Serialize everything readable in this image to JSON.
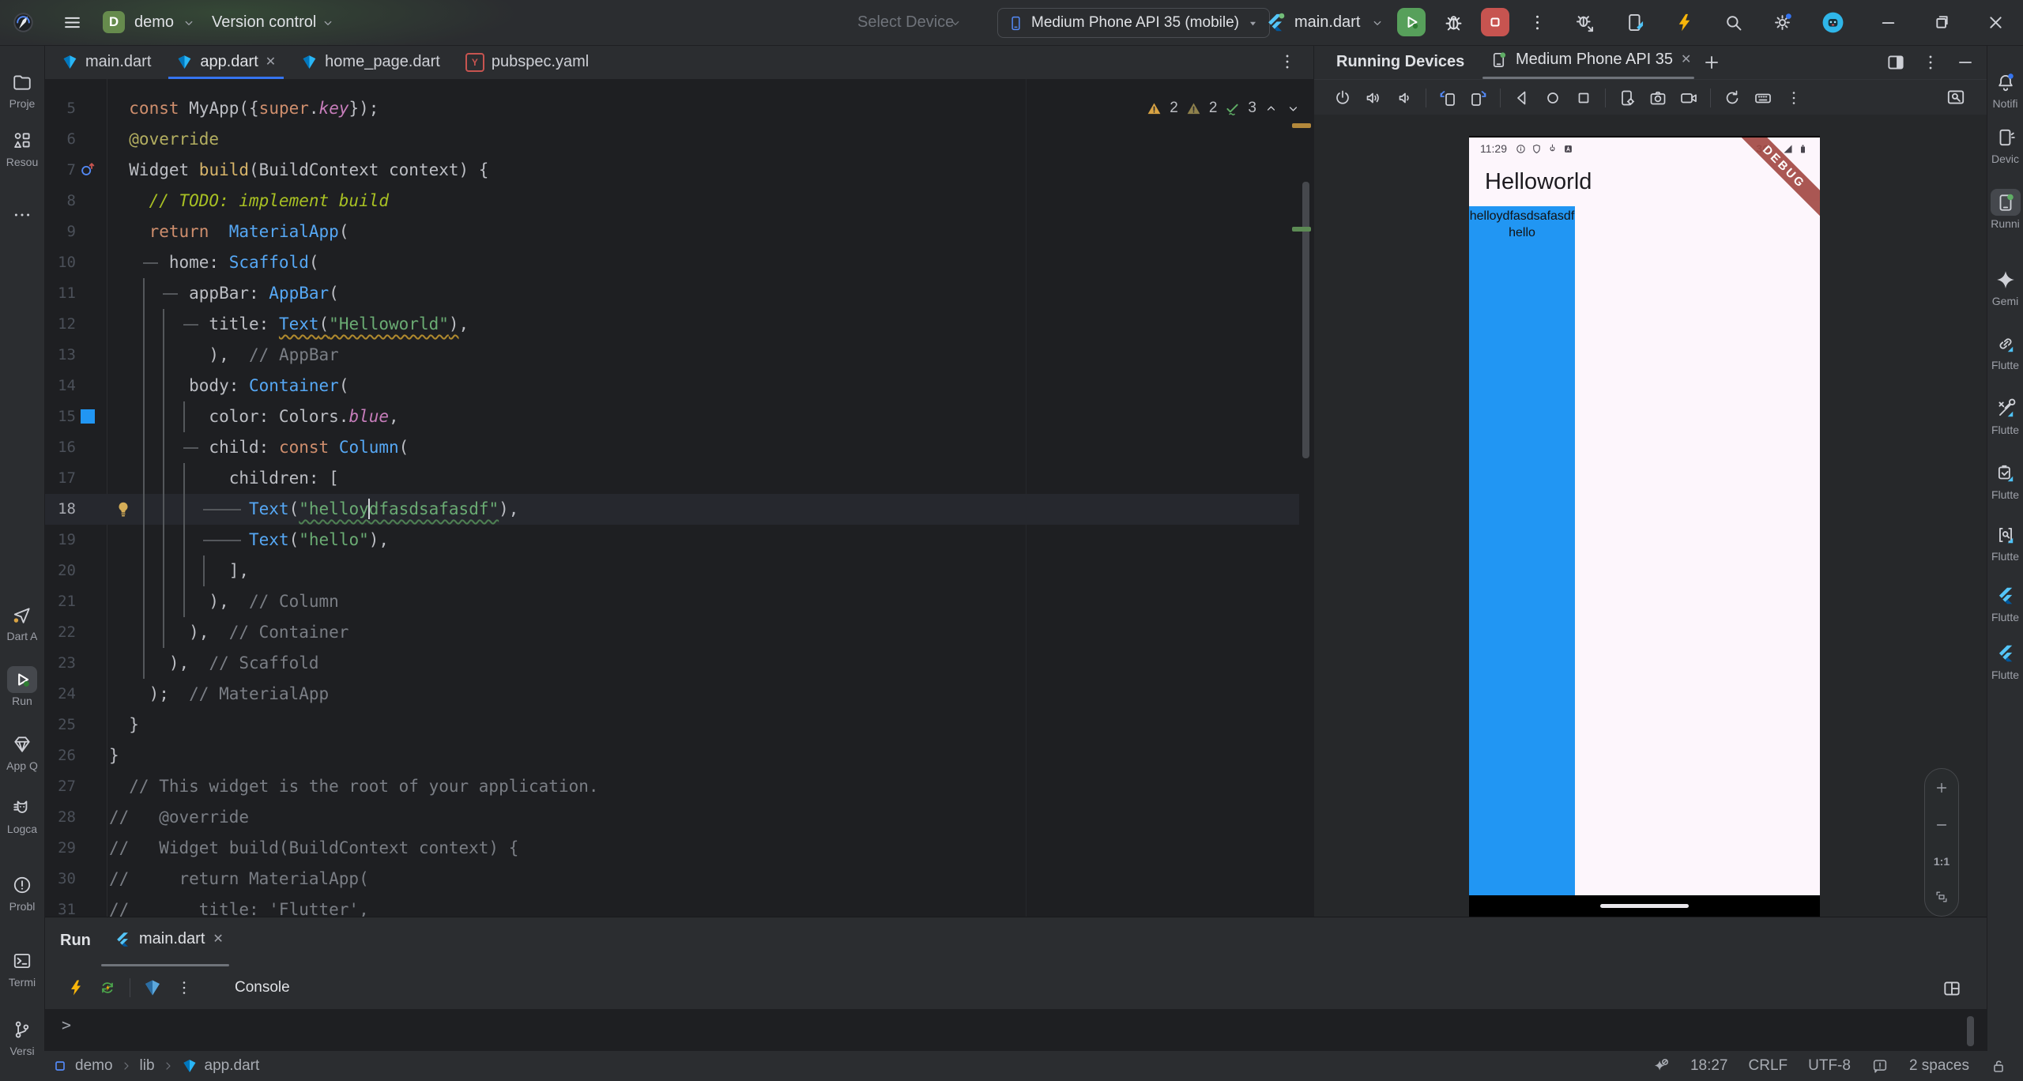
{
  "titlebar": {
    "project": "demo",
    "project_badge": "D",
    "menu": "Version control",
    "select_device": "Select Device",
    "device": "Medium Phone API 35 (mobile)",
    "run_config": "main.dart",
    "right_icons": [
      "bug-attach",
      "flutter-attach",
      "bolt",
      "search",
      "settings",
      "avatar",
      "minimize",
      "restore",
      "close"
    ]
  },
  "editor": {
    "tabs": [
      {
        "label": "main.dart",
        "icon": "dart",
        "active": false,
        "closable": false
      },
      {
        "label": "app.dart",
        "icon": "dart",
        "active": true,
        "closable": true
      },
      {
        "label": "home_page.dart",
        "icon": "dart",
        "active": false,
        "closable": false
      },
      {
        "label": "pubspec.yaml",
        "icon": "yaml",
        "active": false,
        "closable": false
      }
    ],
    "inspections": {
      "warnings": "2",
      "weak_warnings": "2",
      "passed": "3"
    },
    "lines": [
      {
        "n": 5,
        "t": [
          [
            "kw",
            "  const"
          ],
          [
            "id",
            " MyApp({"
          ],
          [
            "kw",
            "super"
          ],
          [
            "id",
            "."
          ],
          [
            "fld",
            "key"
          ],
          [
            "id",
            "});"
          ]
        ]
      },
      {
        "n": 6,
        "t": [
          [
            "ann",
            "  @override"
          ]
        ]
      },
      {
        "n": 7,
        "gut": "override",
        "t": [
          [
            "id",
            "  Widget "
          ],
          [
            "mth",
            "build"
          ],
          [
            "id",
            "(BuildContext context) {"
          ]
        ]
      },
      {
        "n": 8,
        "t": [
          [
            "todo",
            "    // TODO: implement build"
          ]
        ]
      },
      {
        "n": 9,
        "t": [
          [
            "kw",
            "    return"
          ],
          [
            "id",
            "  "
          ],
          [
            "cls",
            "MaterialApp"
          ],
          [
            "id",
            "("
          ]
        ]
      },
      {
        "n": 10,
        "conn": [
          3.4,
          4.9
        ],
        "t": [
          [
            "id",
            "      home: "
          ],
          [
            "cls",
            "Scaffold"
          ],
          [
            "id",
            "("
          ]
        ]
      },
      {
        "n": 11,
        "vg": [
          3.4
        ],
        "conn": [
          5.4,
          6.9
        ],
        "t": [
          [
            "id",
            "        appBar: "
          ],
          [
            "cls",
            "AppBar"
          ],
          [
            "id",
            "("
          ]
        ]
      },
      {
        "n": 12,
        "vg": [
          3.4,
          5.4
        ],
        "conn": [
          7.4,
          8.9
        ],
        "t": [
          [
            "id",
            "          title: "
          ],
          [
            "cls wy",
            "Text"
          ],
          [
            "id wy",
            "("
          ],
          [
            "str wy",
            "\"Helloworld\""
          ],
          [
            "id wy",
            ")"
          ],
          [
            "id",
            ","
          ]
        ]
      },
      {
        "n": 13,
        "vg": [
          3.4,
          5.4
        ],
        "t": [
          [
            "id",
            "          ),  "
          ],
          [
            "cmt",
            "// AppBar"
          ]
        ]
      },
      {
        "n": 14,
        "vg": [
          3.4,
          5.4
        ],
        "t": [
          [
            "id",
            "        body: "
          ],
          [
            "cls",
            "Container"
          ],
          [
            "id",
            "("
          ]
        ]
      },
      {
        "n": 15,
        "gut": "color",
        "vg": [
          3.4,
          5.4,
          7.4
        ],
        "t": [
          [
            "id",
            "          color: Colors."
          ],
          [
            "fld",
            "blue"
          ],
          [
            "id",
            ","
          ]
        ]
      },
      {
        "n": 16,
        "vg": [
          3.4,
          5.4
        ],
        "conn": [
          7.4,
          8.9
        ],
        "t": [
          [
            "id",
            "          child: "
          ],
          [
            "kw",
            "const"
          ],
          [
            "id",
            " "
          ],
          [
            "cls",
            "Column"
          ],
          [
            "id",
            "("
          ]
        ]
      },
      {
        "n": 17,
        "vg": [
          3.4,
          5.4,
          7.4
        ],
        "t": [
          [
            "id",
            "            children: ["
          ]
        ]
      },
      {
        "n": 18,
        "cur": true,
        "gut": "bulb",
        "vg": [
          3.4,
          5.4,
          7.4
        ],
        "conn": [
          9.4,
          13.2
        ],
        "t": [
          [
            "id",
            "              "
          ],
          [
            "cls",
            "Text"
          ],
          [
            "id",
            "("
          ],
          [
            "str wg",
            "\"helloy"
          ],
          [
            "caret",
            ""
          ],
          [
            "str wg",
            "dfasdsafasdf\""
          ],
          [
            "id",
            "),"
          ]
        ]
      },
      {
        "n": 19,
        "vg": [
          3.4,
          5.4,
          7.4
        ],
        "conn": [
          9.4,
          13.2
        ],
        "t": [
          [
            "id",
            "              "
          ],
          [
            "cls",
            "Text"
          ],
          [
            "id",
            "("
          ],
          [
            "str",
            "\"hello\""
          ],
          [
            "id",
            "),"
          ]
        ]
      },
      {
        "n": 20,
        "vg": [
          3.4,
          5.4,
          7.4,
          9.4
        ],
        "t": [
          [
            "id",
            "            ],"
          ]
        ]
      },
      {
        "n": 21,
        "vg": [
          3.4,
          5.4,
          7.4
        ],
        "t": [
          [
            "id",
            "          ),  "
          ],
          [
            "cmt",
            "// Column"
          ]
        ]
      },
      {
        "n": 22,
        "vg": [
          3.4,
          5.4
        ],
        "t": [
          [
            "id",
            "        ),  "
          ],
          [
            "cmt",
            "// Container"
          ]
        ]
      },
      {
        "n": 23,
        "vg": [
          3.4
        ],
        "t": [
          [
            "id",
            "      ),  "
          ],
          [
            "cmt",
            "// Scaffold"
          ]
        ]
      },
      {
        "n": 24,
        "t": [
          [
            "id",
            "    );  "
          ],
          [
            "cmt",
            "// MaterialApp"
          ]
        ]
      },
      {
        "n": 25,
        "t": [
          [
            "id",
            "  }"
          ]
        ]
      },
      {
        "n": 26,
        "t": [
          [
            "id",
            "}"
          ]
        ]
      },
      {
        "n": 27,
        "t": [
          [
            "cmt",
            "  // This widget is the root of your application."
          ]
        ]
      },
      {
        "n": 28,
        "t": [
          [
            "cmt",
            "//   @override"
          ]
        ]
      },
      {
        "n": 29,
        "t": [
          [
            "cmt",
            "//   Widget build(BuildContext context) {"
          ]
        ]
      },
      {
        "n": 30,
        "t": [
          [
            "cmt",
            "//     return MaterialApp("
          ]
        ]
      },
      {
        "n": 31,
        "t": [
          [
            "cmt",
            "//       title: 'Flutter',"
          ]
        ]
      }
    ]
  },
  "devices_panel": {
    "title": "Running Devices",
    "tab": "Medium Phone API 35",
    "zoom_label": "1:1",
    "toolbar_icons": [
      "power",
      "volume-up",
      "volume-down",
      "|",
      "rotate-left",
      "rotate-right",
      "|",
      "back",
      "home",
      "recents",
      "|",
      "phone-settings",
      "camera",
      "video",
      "|",
      "restart",
      "keyboard",
      "kebab"
    ]
  },
  "emulator": {
    "time": "11:29",
    "status_icons": [
      "info",
      "shield",
      "vial",
      "box-a"
    ],
    "network": "3G",
    "app_title": "Helloworld",
    "line1": "helloydfasdsafasdf",
    "line2": "hello",
    "debug_banner": "DEBUG"
  },
  "run_panel": {
    "title": "Run",
    "tab": "main.dart",
    "console": "Console",
    "prompt": ">"
  },
  "left_strip": [
    {
      "icon": "folder",
      "label": "Proje"
    },
    {
      "icon": "resources",
      "label": "Resou"
    },
    {
      "icon": "more",
      "label": ""
    },
    {
      "icon": "dart-analysis",
      "label": "Dart A"
    },
    {
      "icon": "play",
      "label": "Run",
      "active": true
    },
    {
      "icon": "diamond",
      "label": "App Q"
    },
    {
      "icon": "logcat",
      "label": "Logca"
    },
    {
      "icon": "problems",
      "label": "Probl"
    },
    {
      "icon": "terminal",
      "label": "Termi"
    },
    {
      "icon": "branch",
      "label": "Versi"
    }
  ],
  "right_strip": [
    {
      "icon": "bell",
      "label": "Notifi"
    },
    {
      "icon": "device-manager",
      "label": "Devic"
    },
    {
      "icon": "running-devices",
      "label": "Runni",
      "active": true
    },
    {
      "icon": "gemini",
      "label": "Gemi"
    },
    {
      "icon": "flutter-link",
      "label": "Flutte"
    },
    {
      "icon": "flutter-tools",
      "label": "Flutte"
    },
    {
      "icon": "flutter-board",
      "label": "Flutte"
    },
    {
      "icon": "flutter-inspector",
      "label": "Flutte"
    },
    {
      "icon": "flutter",
      "label": "Flutte"
    },
    {
      "icon": "flutter",
      "label": "Flutte"
    }
  ],
  "statusbar": {
    "crumbs": [
      "demo",
      "lib"
    ],
    "file": "app.dart",
    "caret": "18:27",
    "line_ending": "CRLF",
    "encoding": "UTF-8",
    "indent": "2 spaces"
  },
  "colors": {
    "accent": "#3574F0",
    "run_green": "#57A05B",
    "stop_red": "#C75450",
    "device_blue": "#2196F3",
    "debug_ribbon": "#A34A45"
  }
}
